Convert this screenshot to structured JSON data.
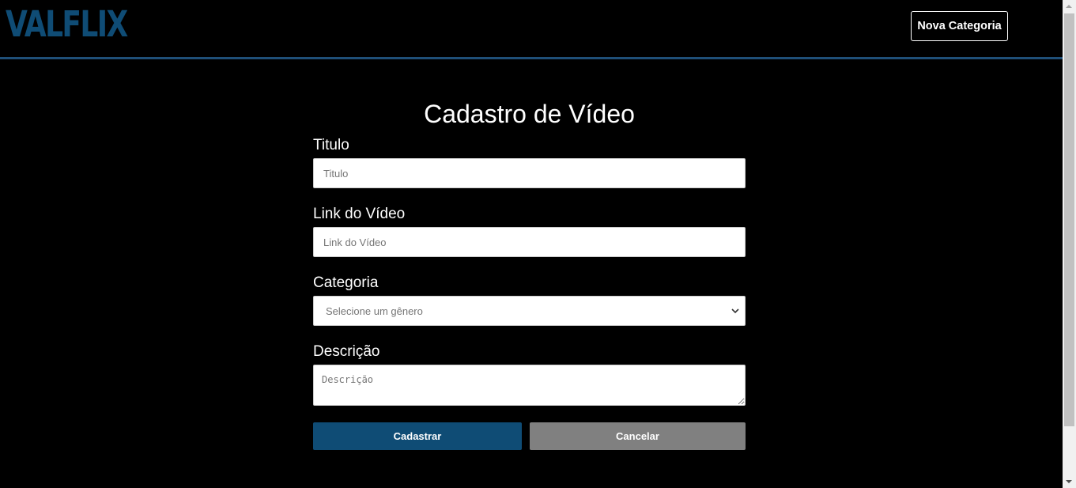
{
  "header": {
    "logo_text": "VALFLIX",
    "nav_button_label": "Nova Categoria"
  },
  "form": {
    "title": "Cadastro de Vídeo",
    "fields": {
      "titulo": {
        "label": "Titulo",
        "placeholder": "Titulo",
        "value": ""
      },
      "link": {
        "label": "Link do Vídeo",
        "placeholder": "Link do Vídeo",
        "value": ""
      },
      "categoria": {
        "label": "Categoria",
        "selected": "Selecione um gênero"
      },
      "descricao": {
        "label": "Descrição",
        "placeholder": "Descrição",
        "value": ""
      }
    },
    "submit_label": "Cadastrar",
    "cancel_label": "Cancelar"
  },
  "colors": {
    "brand": "#0f4c75",
    "background": "#000000",
    "cancel": "#808080"
  },
  "icons": {
    "select": "chevron-down-icon"
  }
}
